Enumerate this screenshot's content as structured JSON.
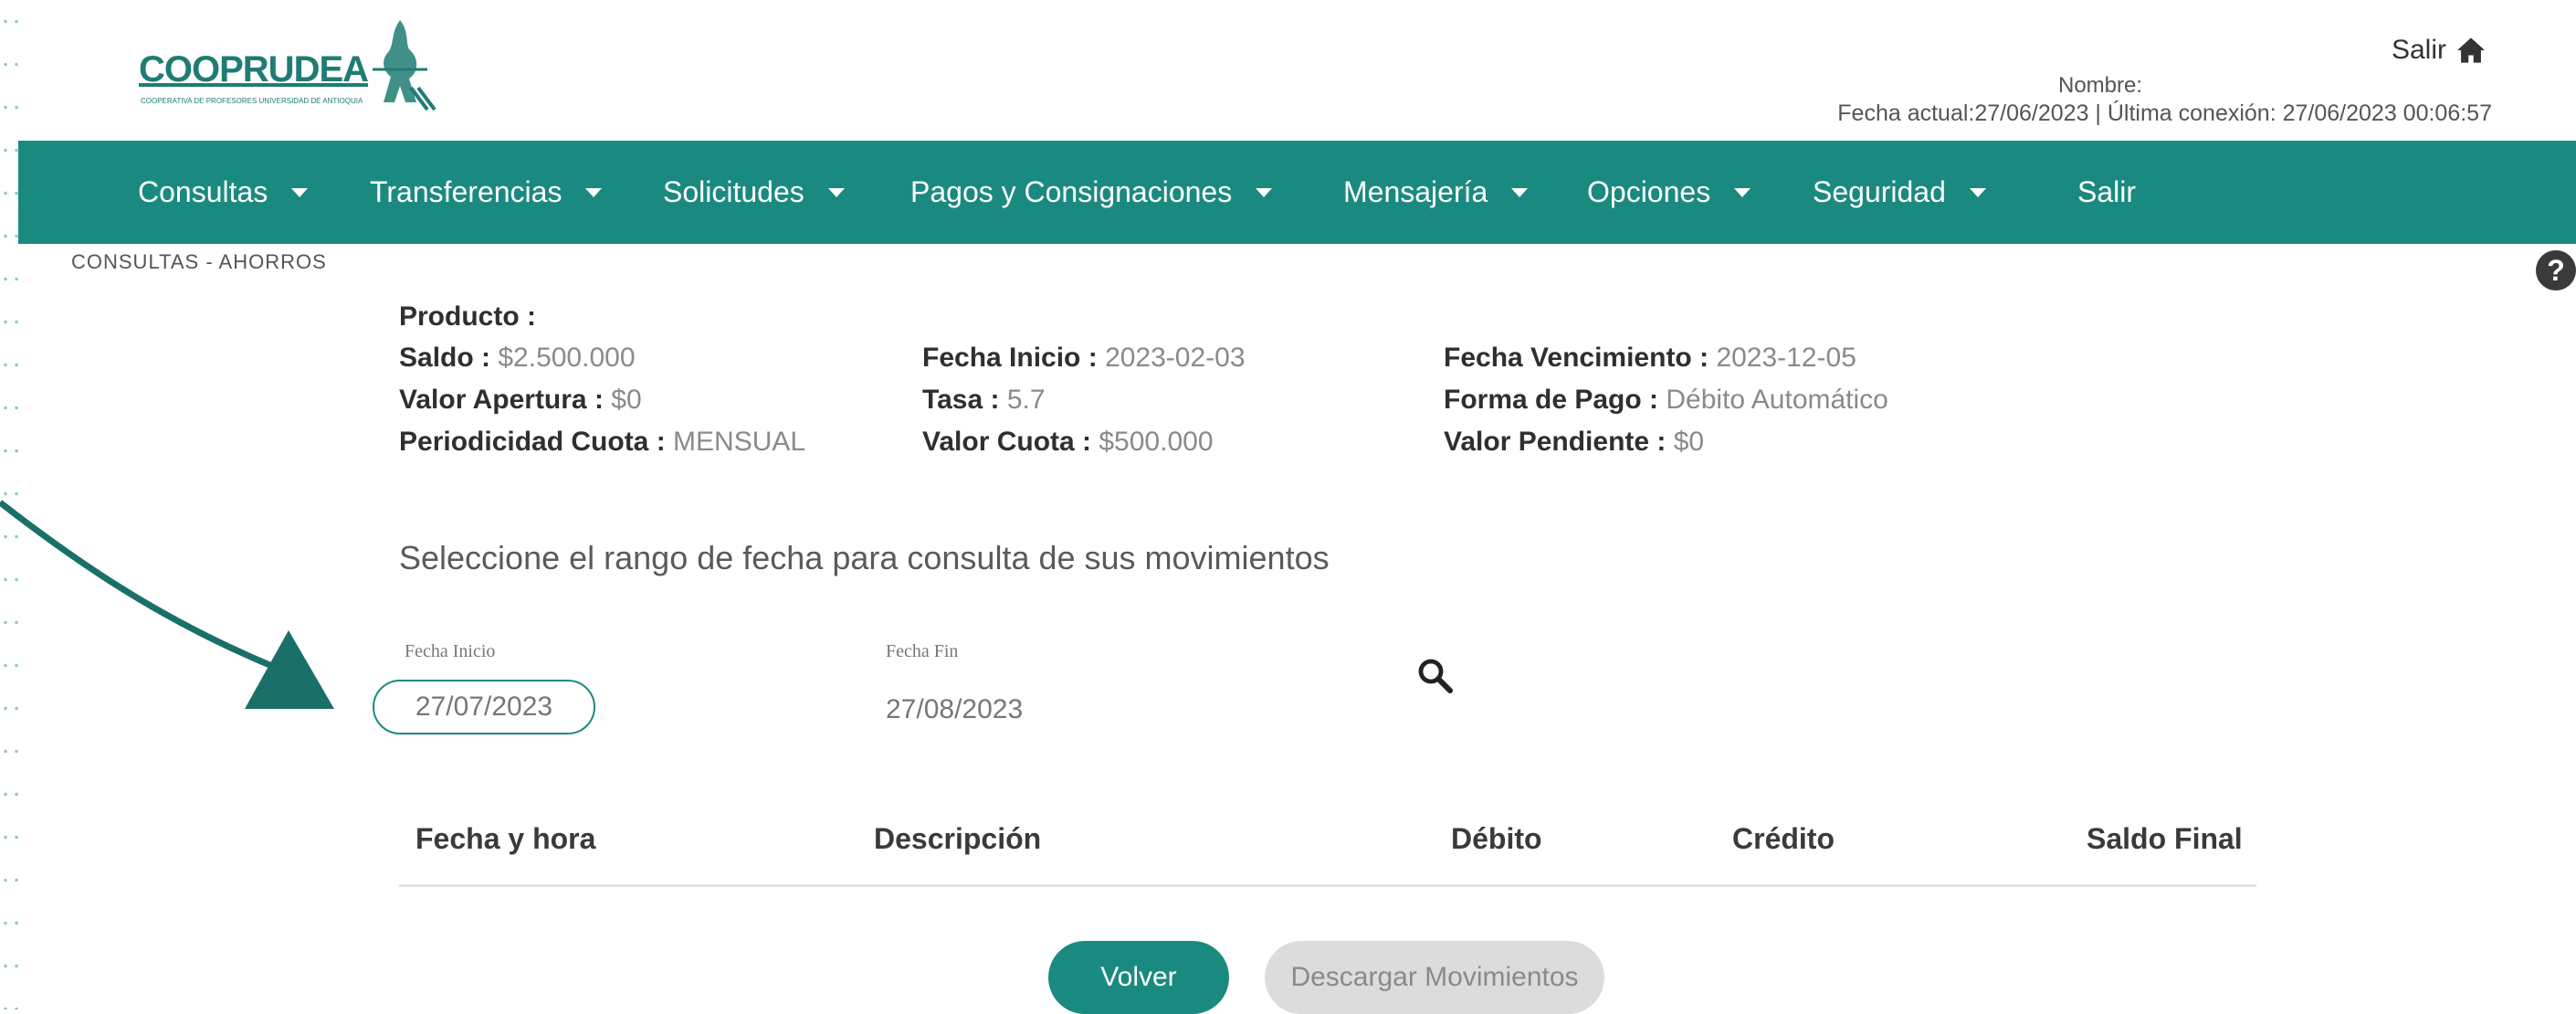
{
  "header": {
    "logo_text": "COOPRUDEA",
    "logo_subtext": "COOPERATIVA DE PROFESORES UNIVERSIDAD DE ANTIOQUIA",
    "exit_label": "Salir",
    "name_line": "Nombre:",
    "dates_line": "Fecha actual:27/06/2023 | Última conexión: 27/06/2023 00:06:57"
  },
  "nav": {
    "items": [
      {
        "label": "Consultas"
      },
      {
        "label": "Transferencias"
      },
      {
        "label": "Solicitudes"
      },
      {
        "label": "Pagos y Consignaciones"
      },
      {
        "label": "Mensajería"
      },
      {
        "label": "Opciones"
      },
      {
        "label": "Seguridad"
      },
      {
        "label": "Salir"
      }
    ]
  },
  "breadcrumb": "CONSULTAS - AHORROS",
  "help_icon": "?",
  "product": {
    "product_label": "Producto :",
    "col1": [
      {
        "label": "Saldo :",
        "value": "$2.500.000"
      },
      {
        "label": "Valor Apertura :",
        "value": "$0"
      },
      {
        "label": "Periodicidad Cuota :",
        "value": "MENSUAL"
      }
    ],
    "col2": [
      {
        "label": "Fecha Inicio :",
        "value": "2023-02-03"
      },
      {
        "label": "Tasa :",
        "value": "5.7"
      },
      {
        "label": "Valor Cuota :",
        "value": "$500.000"
      }
    ],
    "col3": [
      {
        "label": "Fecha Vencimiento :",
        "value": "2023-12-05"
      },
      {
        "label": "Forma de Pago :",
        "value": "Débito Automático"
      },
      {
        "label": "Valor Pendiente :",
        "value": "$0"
      }
    ]
  },
  "range": {
    "title": "Seleccione el rango de fecha para consulta de sus movimientos",
    "start_label": "Fecha Inicio",
    "start_value": "27/07/2023",
    "end_label": "Fecha Fin",
    "end_value": "27/08/2023"
  },
  "table": {
    "columns": [
      "Fecha y hora",
      "Descripción",
      "Débito",
      "Crédito",
      "Saldo Final"
    ]
  },
  "buttons": {
    "back": "Volver",
    "download": "Descargar Movimientos"
  },
  "icons": {
    "home": "home-icon",
    "search": "search-icon",
    "help": "help-icon",
    "caret": "caret-down-icon",
    "arrow": "annotation-arrow"
  },
  "colors": {
    "primary": "#1a8a80",
    "text": "#3a3a3a",
    "muted": "#8a8a8a"
  }
}
